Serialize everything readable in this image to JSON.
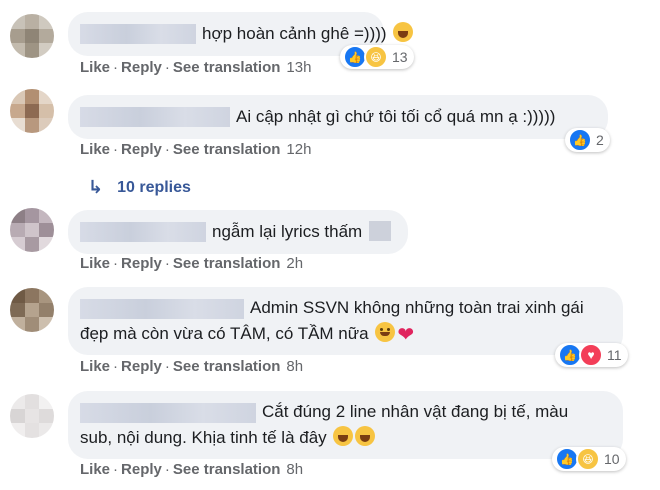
{
  "comments": [
    {
      "text": "hợp hoàn cảnh ghê =))))",
      "emojis": [
        "laugh-wink-emoji"
      ],
      "actions": {
        "like": "Like",
        "reply": "Reply",
        "translate": "See translation",
        "time": "13h"
      },
      "reactions": {
        "types": [
          "like",
          "haha"
        ],
        "count": "13"
      }
    },
    {
      "text": "Ai cập nhật gì chứ tôi tối cổ quá mn ạ :)))))",
      "actions": {
        "like": "Like",
        "reply": "Reply",
        "translate": "See translation",
        "time": "12h"
      },
      "reactions": {
        "types": [
          "like"
        ],
        "count": "2"
      }
    },
    {
      "text": "ngẫm lại lyrics thấm",
      "actions": {
        "like": "Like",
        "reply": "Reply",
        "translate": "See translation",
        "time": "2h"
      }
    },
    {
      "text_line1": "Admin SSVN không những toàn trai xinh gái",
      "text_line2": "đẹp mà còn vừa có TÂM, có TẦM nữa",
      "emojis": [
        "smiling-emoji",
        "red-heart"
      ],
      "actions": {
        "like": "Like",
        "reply": "Reply",
        "translate": "See translation",
        "time": "8h"
      },
      "reactions": {
        "types": [
          "like",
          "love"
        ],
        "count": "11"
      }
    },
    {
      "text_line1": "Cắt đúng 2 line nhân vật đang bị tế, màu",
      "text_line2": "sub, nội dung. Khịa tinh tế là đây",
      "emojis": [
        "tears-of-joy-emoji",
        "tears-of-joy-emoji"
      ],
      "actions": {
        "like": "Like",
        "reply": "Reply",
        "translate": "See translation",
        "time": "8h"
      },
      "reactions": {
        "types": [
          "like",
          "haha"
        ],
        "count": "10"
      }
    }
  ],
  "replies_link": "10 replies",
  "colors": {
    "bubble": "#f0f2f5",
    "link": "#385898",
    "meta": "#65676b",
    "like": "#1877f2",
    "love": "#f33e58",
    "haha": "#f7c442"
  }
}
